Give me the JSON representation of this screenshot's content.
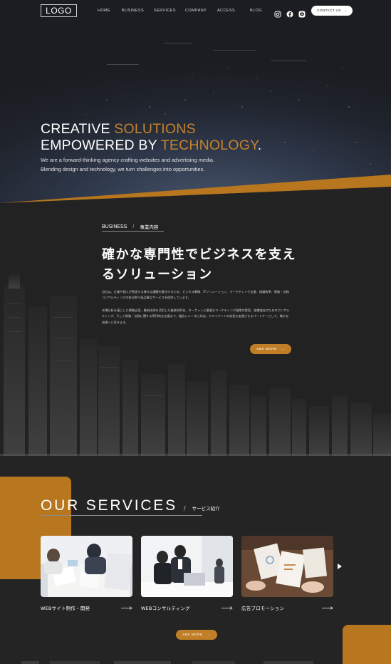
{
  "header": {
    "logo": "LOGO",
    "nav": [
      "HOME",
      "BUSINESS",
      "SERVICES",
      "COMPANY",
      "ACCESS",
      "BLOG"
    ],
    "social_icons": [
      "instagram-icon",
      "facebook-icon",
      "line-icon"
    ],
    "contact_label": "CONTACT US",
    "contact_arrow": "→"
  },
  "hero": {
    "title_line1_white": "CREATIVE ",
    "title_line1_gold": "SOLUTIONS",
    "title_line2_white": "EMPOWERED BY ",
    "title_line2_gold": "TECHNOLOGY",
    "title_line2_end": ".",
    "subtitle_line1": "We are a forward-thinking agency crafting websites and advertising media.",
    "subtitle_line2": "Blending design and technology, we turn challenges into opportunities.",
    "accent_color": "#c6832a"
  },
  "business": {
    "eyebrow_en": "BUSINESS",
    "eyebrow_sep": "/",
    "eyebrow_jp": "事業内容",
    "heading": "確かな専門性でビジネスを支えるソリューション",
    "paragraph1": "当社は、企業や個人が直面する様々な課題を解決するため、ビジネス戦略、ITソリューション、マーケティング支援、組織改革、財務・法務コンサルティングの各分野で高品質なサービスを提供しています。",
    "paragraph2": "市場分析を基にした戦略立案、最新技術を活用した業務効率化、ターゲットに最適なマーケティング施策の提案、組織強化のためのコンサルティング、そして財務・法務に関する専門的な支援まで、幅広いニーズに対応。クライアントの成長を加速させるパートナーとして、確かな成果へと導きます。",
    "see_more": "SEE MORE",
    "see_more_arrow": "→"
  },
  "services": {
    "title": "OUR SERVICES",
    "sep": "/",
    "title_jp": "サービス紹介",
    "cards": [
      {
        "label": "WEBサイト制作・開発"
      },
      {
        "label": "WEBコンサルティング"
      },
      {
        "label": "広告プロモーション"
      }
    ],
    "see_more": "SEE MORE",
    "see_more_arrow": "→",
    "accent_color": "#b8771f"
  }
}
